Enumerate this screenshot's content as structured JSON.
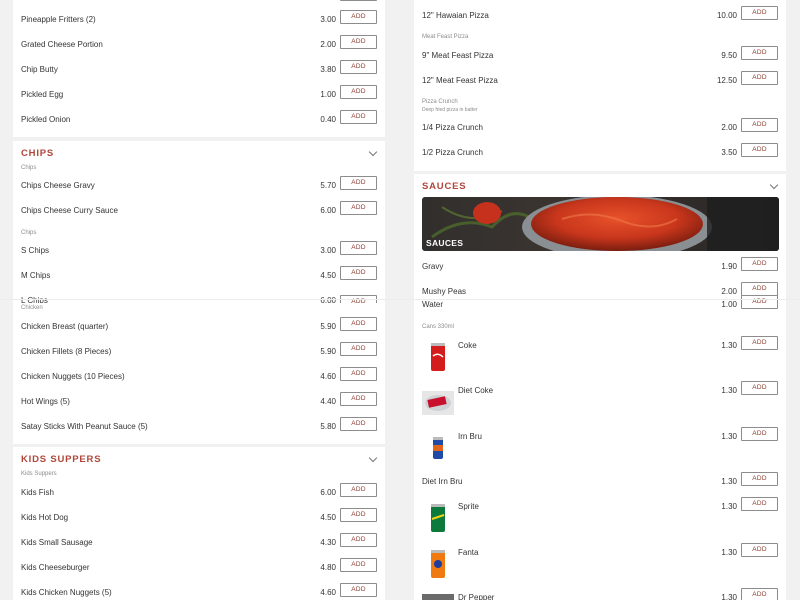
{
  "add_label": "ADD",
  "left": {
    "top_items": [
      {
        "name": "Pineapple Fritters (2)",
        "price": "3.00"
      },
      {
        "name": "Grated Cheese Portion",
        "price": "2.00"
      },
      {
        "name": "Chip Butty",
        "price": "3.80"
      },
      {
        "name": "Pickled Egg",
        "price": "1.00"
      },
      {
        "name": "Pickled Onion",
        "price": "0.40"
      }
    ],
    "chips": {
      "title": "CHIPS",
      "group1": "Chips",
      "items1": [
        {
          "name": "Chips Cheese Gravy",
          "price": "5.70"
        },
        {
          "name": "Chips Cheese Curry Sauce",
          "price": "6.00"
        }
      ],
      "group2": "Chips",
      "items2": [
        {
          "name": "S Chips",
          "price": "3.00"
        },
        {
          "name": "M Chips",
          "price": "4.50"
        },
        {
          "name": "L Chips",
          "price": "6.00"
        }
      ]
    },
    "chicken": {
      "group": "Chicken",
      "items": [
        {
          "name": "Chicken Breast (quarter)",
          "price": "5.90"
        },
        {
          "name": "Chicken Fillets (8 Pieces)",
          "price": "5.90"
        },
        {
          "name": "Chicken Nuggets (10 Pieces)",
          "price": "4.60"
        },
        {
          "name": "Hot Wings (5)",
          "price": "4.40"
        },
        {
          "name": "Satay Sticks With Peanut Sauce (5)",
          "price": "5.80"
        }
      ]
    },
    "kids": {
      "title": "KIDS SUPPERS",
      "group": "Kids Suppers",
      "items": [
        {
          "name": "Kids Fish",
          "price": "6.00"
        },
        {
          "name": "Kids Hot Dog",
          "price": "4.50"
        },
        {
          "name": "Kids Small Sausage",
          "price": "4.30"
        },
        {
          "name": "Kids Cheeseburger",
          "price": "4.80"
        },
        {
          "name": "Kids Chicken Nuggets (5)",
          "price": "4.60"
        }
      ]
    }
  },
  "right": {
    "top_items": [
      {
        "name": "12\" Hawaian Pizza",
        "price": "10.00"
      }
    ],
    "meat_feast": {
      "group": "Meat Feast Pizza",
      "items": [
        {
          "name": "9\" Meat Feast Pizza",
          "price": "9.50"
        },
        {
          "name": "12\" Meat Feast Pizza",
          "price": "12.50"
        }
      ]
    },
    "crunch": {
      "group": "Pizza Crunch",
      "subtitle": "Deep fried pizza in batter",
      "items": [
        {
          "name": "1/4 Pizza Crunch",
          "price": "2.00"
        },
        {
          "name": "1/2 Pizza Crunch",
          "price": "3.50"
        }
      ]
    },
    "sauces": {
      "title": "SAUCES",
      "banner_label": "SAUCES",
      "items": [
        {
          "name": "Gravy",
          "price": "1.90"
        },
        {
          "name": "Mushy Peas",
          "price": "2.00"
        },
        {
          "name": "Water",
          "price": "1.00"
        }
      ]
    },
    "cans": {
      "group": "Cans 330ml",
      "items": [
        {
          "name": "Coke",
          "price": "1.30",
          "icon": "coke-can-icon"
        },
        {
          "name": "Diet Coke",
          "price": "1.30",
          "icon": "diet-coke-can-icon"
        },
        {
          "name": "Irn Bru",
          "price": "1.30",
          "icon": "irn-bru-can-icon"
        },
        {
          "name": "Diet Irn Bru",
          "price": "1.30",
          "icon": ""
        },
        {
          "name": "Sprite",
          "price": "1.30",
          "icon": "sprite-can-icon"
        },
        {
          "name": "Fanta",
          "price": "1.30",
          "icon": "fanta-can-icon"
        },
        {
          "name": "Dr Pepper",
          "price": "1.30",
          "icon": "dr-pepper-can-icon"
        }
      ]
    }
  },
  "colors": {
    "accent": "#b0463a",
    "page_bg": "#f1f1f1",
    "card_bg": "#ffffff"
  }
}
